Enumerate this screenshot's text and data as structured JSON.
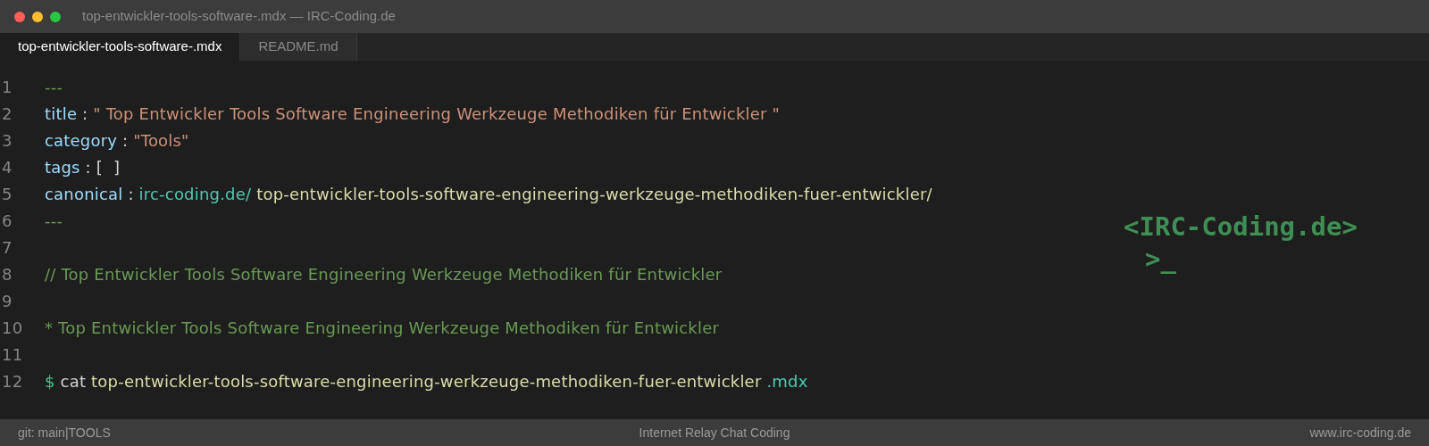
{
  "window": {
    "title": "top-entwickler-tools-software-.mdx — IRC-Coding.de"
  },
  "tabs": [
    {
      "label": "top-entwickler-tools-software-.mdx",
      "selected": true
    },
    {
      "label": "README.md",
      "selected": false
    }
  ],
  "editor": {
    "lines": [
      {
        "number": "1",
        "tokens": [
          {
            "kind": "comment",
            "text": "---"
          }
        ]
      },
      {
        "number": "2",
        "tokens": [
          {
            "kind": "key",
            "text": "title"
          },
          {
            "kind": "punct",
            "text": " : "
          },
          {
            "kind": "string",
            "text": "\" Top Entwickler Tools Software Engineering Werkzeuge Methodiken für Entwickler \""
          }
        ]
      },
      {
        "number": "3",
        "tokens": [
          {
            "kind": "key",
            "text": "category"
          },
          {
            "kind": "punct",
            "text": " : "
          },
          {
            "kind": "string",
            "text": "\"Tools\""
          }
        ]
      },
      {
        "number": "4",
        "tokens": [
          {
            "kind": "key",
            "text": "tags"
          },
          {
            "kind": "punct",
            "text": " : [  ]"
          }
        ]
      },
      {
        "number": "5",
        "tokens": [
          {
            "kind": "key",
            "text": "canonical"
          },
          {
            "kind": "punct",
            "text": " : "
          },
          {
            "kind": "link",
            "text": "irc-coding.de/"
          },
          {
            "kind": "path",
            "text": " top-entwickler-tools-software-engineering-werkzeuge-methodiken-fuer-entwickler/"
          }
        ]
      },
      {
        "number": "6",
        "tokens": [
          {
            "kind": "comment",
            "text": "---"
          }
        ]
      },
      {
        "number": "7"
      },
      {
        "number": "8",
        "tokens": [
          {
            "kind": "comment",
            "text": "// Top Entwickler Tools Software Engineering Werkzeuge Methodiken für Entwickler"
          }
        ]
      },
      {
        "number": "9"
      },
      {
        "number": "10",
        "tokens": [
          {
            "kind": "comment",
            "text": "* Top Entwickler Tools Software Engineering Werkzeuge Methodiken für Entwickler"
          }
        ]
      },
      {
        "number": "11"
      },
      {
        "number": "12",
        "tokens": [
          {
            "kind": "prompt",
            "text": "$"
          },
          {
            "kind": "punct",
            "text": " cat "
          },
          {
            "kind": "path",
            "text": "top-entwickler-tools-software-engineering-werkzeuge-methodiken-fuer-entwickler"
          },
          {
            "kind": "link",
            "text": " .mdx"
          }
        ]
      }
    ]
  },
  "logo": {
    "name": "<IRC-Coding.de>",
    "prompt": ">_"
  },
  "status_bar": {
    "left": "git: main|TOOLS",
    "center": "Internet Relay Chat Coding",
    "right": "www.irc-coding.de"
  }
}
